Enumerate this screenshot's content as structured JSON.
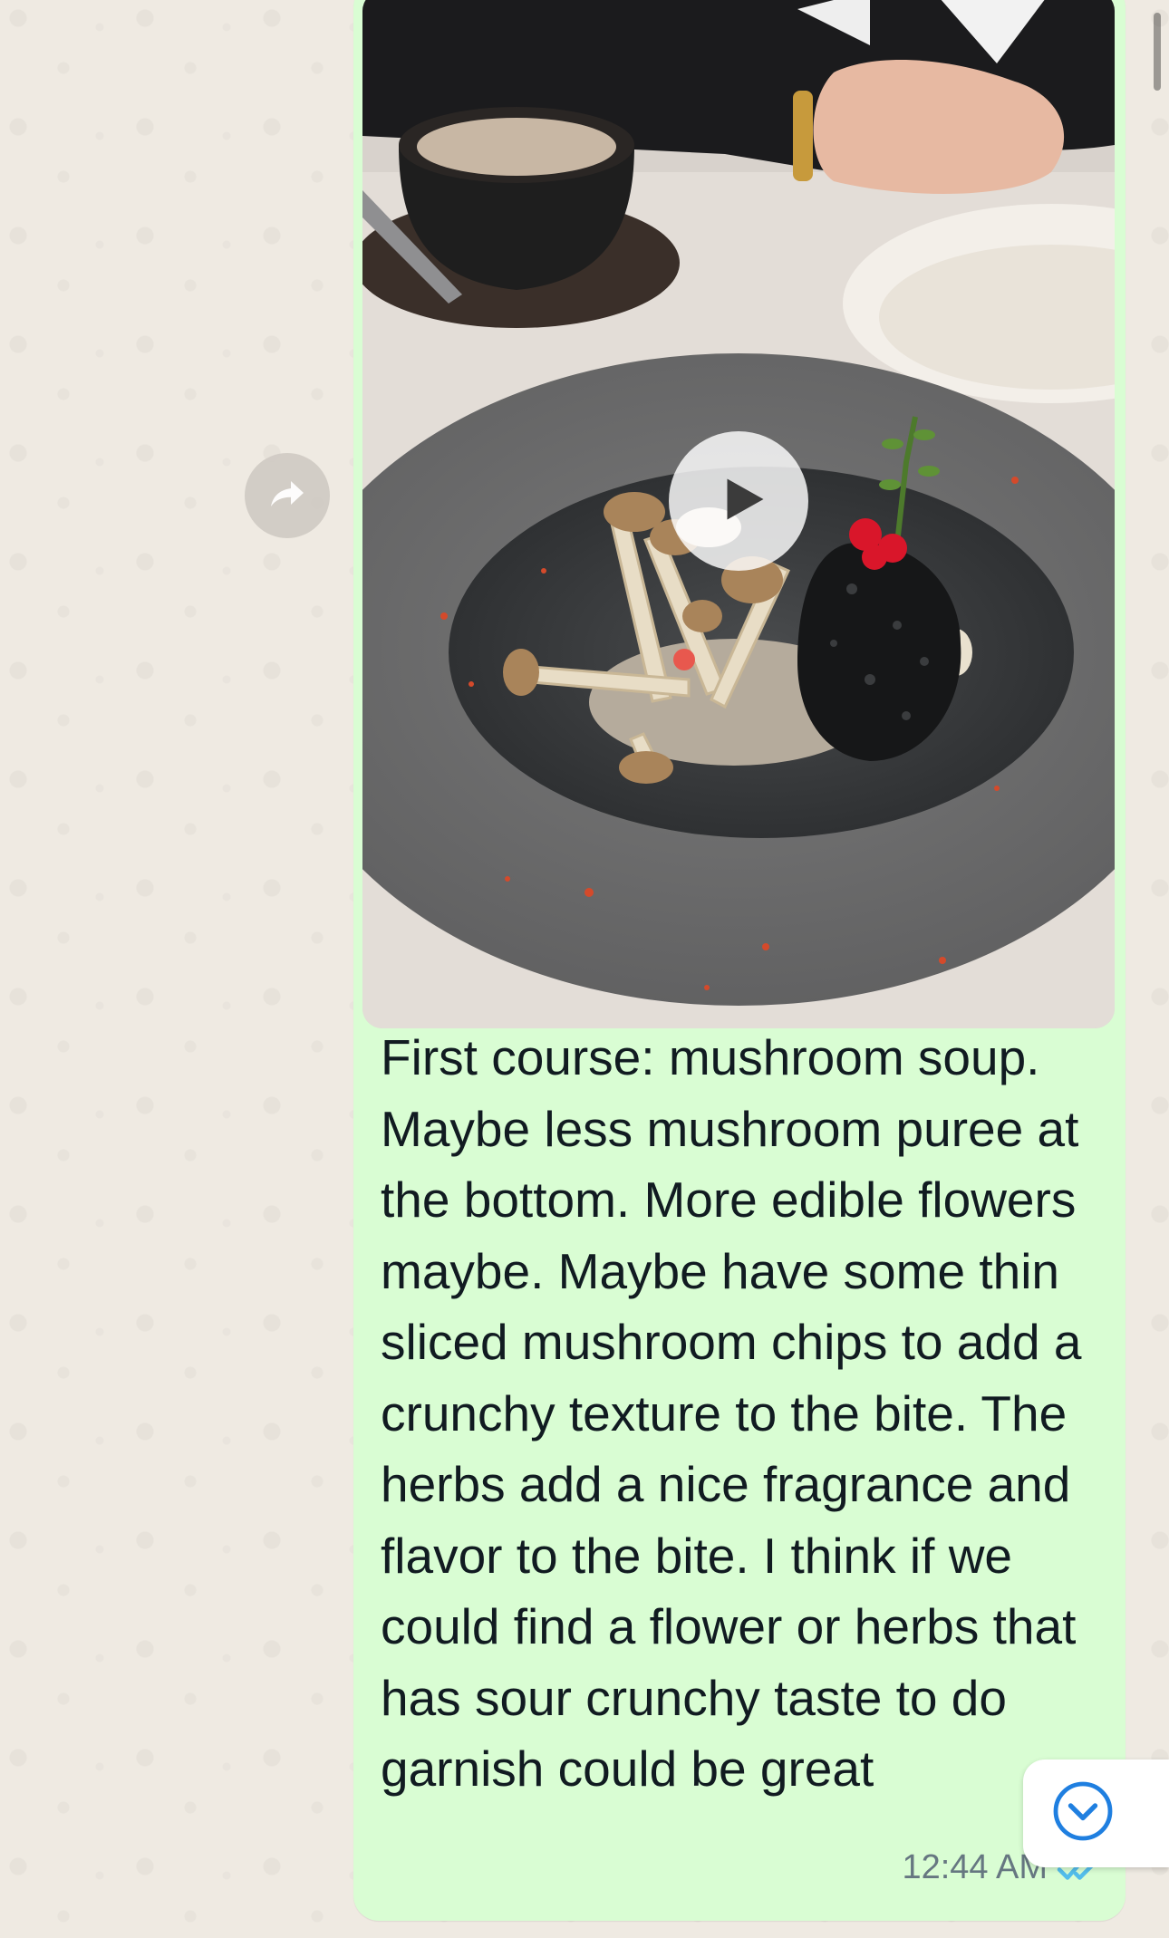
{
  "message": {
    "caption": "First course: mushroom soup. Maybe less mushroom puree at the bottom. More edible flowers maybe. Maybe have some thin sliced mushroom chips to add a crunchy texture to the bite. The herbs add a nice fragrance and flavor to the bite. I think if we could find a flower or herbs that has sour crunchy taste to do garnish could be great",
    "time": "12:44 AM",
    "status_icon": "double-check-read-icon",
    "media_type": "video",
    "bubble_color": "#d9fdd3"
  },
  "controls": {
    "forward_icon": "forward-arrow-icon",
    "play_icon": "play-icon",
    "scroll_down_icon": "chevron-down-circle-icon"
  },
  "colors": {
    "wallpaper": "#efeae2",
    "accent": "#00a884",
    "read_ticks": "#53bdeb"
  }
}
